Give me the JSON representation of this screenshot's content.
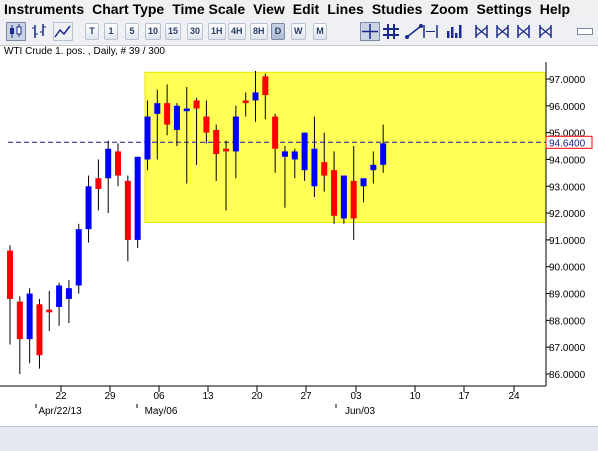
{
  "menu": [
    "Instruments",
    "Chart Type",
    "Time Scale",
    "View",
    "Edit",
    "Lines",
    "Studies",
    "Zoom",
    "Settings",
    "Help"
  ],
  "toolbar": {
    "timeframes": [
      "T",
      "1",
      "5",
      "10",
      "15",
      "30",
      "1H",
      "4H",
      "8H",
      "D",
      "W",
      "M"
    ],
    "active_timeframe": "D"
  },
  "chart_title": "WTI Crude 1. pos. , Daily, # 39 / 300",
  "price_axis_labels": [
    "97.0000",
    "96.0000",
    "95.0000",
    "94.0000",
    "93.0000",
    "92.0000",
    "91.0000",
    "90.0000",
    "89.0000",
    "88.0000",
    "87.0000",
    "86.0000"
  ],
  "current_price_label": "94.6400",
  "date_axis": {
    "day_labels": [
      "22",
      "29",
      "06",
      "13",
      "20",
      "27",
      "03",
      "10",
      "17",
      "24"
    ],
    "month_labels": [
      "Apr/22/13",
      "May/06",
      "Jun/03"
    ]
  },
  "chart_data": {
    "type": "candlestick",
    "title": "WTI Crude 1. pos. , Daily, # 39 / 300",
    "ylim": [
      85.6,
      97.9
    ],
    "current_price": 94.64,
    "highlight_zone": {
      "low": 91.65,
      "high": 97.25
    },
    "up_color": "#0000ff",
    "down_color": "#ff0000",
    "zone_color": "#ffff55",
    "candles": [
      {
        "date": "Apr/16",
        "open": 90.6,
        "high": 90.8,
        "low": 87.1,
        "close": 88.8
      },
      {
        "date": "Apr/17",
        "open": 88.7,
        "high": 88.9,
        "low": 86.0,
        "close": 87.3
      },
      {
        "date": "Apr/18",
        "open": 87.3,
        "high": 89.2,
        "low": 86.4,
        "close": 89.0
      },
      {
        "date": "Apr/19",
        "open": 88.6,
        "high": 88.8,
        "low": 86.2,
        "close": 86.7
      },
      {
        "date": "Apr/22",
        "open": 88.4,
        "high": 89.1,
        "low": 87.6,
        "close": 88.3
      },
      {
        "date": "Apr/23",
        "open": 88.5,
        "high": 89.4,
        "low": 87.8,
        "close": 89.3
      },
      {
        "date": "Apr/24",
        "open": 88.8,
        "high": 89.5,
        "low": 87.9,
        "close": 89.2
      },
      {
        "date": "Apr/25",
        "open": 89.3,
        "high": 91.6,
        "low": 89.0,
        "close": 91.4
      },
      {
        "date": "Apr/26",
        "open": 91.4,
        "high": 93.4,
        "low": 90.9,
        "close": 93.0
      },
      {
        "date": "Apr/29",
        "open": 93.3,
        "high": 94.0,
        "low": 92.1,
        "close": 92.9
      },
      {
        "date": "Apr/30",
        "open": 93.3,
        "high": 94.7,
        "low": 92.0,
        "close": 94.4
      },
      {
        "date": "May/01",
        "open": 94.3,
        "high": 94.6,
        "low": 93.0,
        "close": 93.4
      },
      {
        "date": "May/02",
        "open": 93.2,
        "high": 93.4,
        "low": 90.2,
        "close": 91.0
      },
      {
        "date": "May/03",
        "open": 91.0,
        "high": 94.1,
        "low": 90.7,
        "close": 94.1
      },
      {
        "date": "May/06",
        "open": 94.0,
        "high": 96.2,
        "low": 93.6,
        "close": 95.6
      },
      {
        "date": "May/07",
        "open": 95.7,
        "high": 96.6,
        "low": 94.0,
        "close": 96.1
      },
      {
        "date": "May/08",
        "open": 96.1,
        "high": 96.8,
        "low": 94.9,
        "close": 95.3
      },
      {
        "date": "May/09",
        "open": 95.1,
        "high": 96.1,
        "low": 94.5,
        "close": 96.0
      },
      {
        "date": "May/10",
        "open": 95.8,
        "high": 96.7,
        "low": 93.1,
        "close": 95.9
      },
      {
        "date": "May/13",
        "open": 96.2,
        "high": 96.3,
        "low": 93.8,
        "close": 95.9
      },
      {
        "date": "May/14",
        "open": 95.6,
        "high": 96.2,
        "low": 94.6,
        "close": 95.0
      },
      {
        "date": "May/15",
        "open": 95.1,
        "high": 95.3,
        "low": 93.2,
        "close": 94.2
      },
      {
        "date": "May/16",
        "open": 94.4,
        "high": 94.7,
        "low": 92.1,
        "close": 94.3
      },
      {
        "date": "May/17",
        "open": 94.3,
        "high": 96.0,
        "low": 93.3,
        "close": 95.6
      },
      {
        "date": "May/20",
        "open": 96.2,
        "high": 96.5,
        "low": 95.6,
        "close": 96.1
      },
      {
        "date": "May/21",
        "open": 96.2,
        "high": 97.3,
        "low": 95.4,
        "close": 96.5
      },
      {
        "date": "May/22",
        "open": 97.1,
        "high": 97.2,
        "low": 95.5,
        "close": 96.4
      },
      {
        "date": "May/23",
        "open": 95.6,
        "high": 95.7,
        "low": 93.5,
        "close": 94.4
      },
      {
        "date": "May/24",
        "open": 94.1,
        "high": 94.5,
        "low": 92.2,
        "close": 94.3
      },
      {
        "date": "May/28",
        "open": 94.0,
        "high": 94.4,
        "low": 93.3,
        "close": 94.3
      },
      {
        "date": "May/29",
        "open": 93.6,
        "high": 95.0,
        "low": 93.2,
        "close": 95.0
      },
      {
        "date": "May/30",
        "open": 93.0,
        "high": 95.6,
        "low": 92.6,
        "close": 94.4
      },
      {
        "date": "May/31",
        "open": 93.9,
        "high": 95.0,
        "low": 92.8,
        "close": 93.4
      },
      {
        "date": "Jun/03",
        "open": 93.6,
        "high": 94.3,
        "low": 91.6,
        "close": 91.9
      },
      {
        "date": "Jun/04",
        "open": 91.8,
        "high": 93.3,
        "low": 91.6,
        "close": 93.4
      },
      {
        "date": "Jun/05",
        "open": 93.2,
        "high": 94.5,
        "low": 91.0,
        "close": 91.8
      },
      {
        "date": "Jun/06",
        "open": 93.0,
        "high": 93.2,
        "low": 92.4,
        "close": 93.3
      },
      {
        "date": "Jun/07",
        "open": 93.6,
        "high": 94.3,
        "low": 93.1,
        "close": 93.8
      },
      {
        "date": "Jun/10",
        "open": 93.8,
        "high": 95.3,
        "low": 93.5,
        "close": 94.6
      }
    ]
  }
}
